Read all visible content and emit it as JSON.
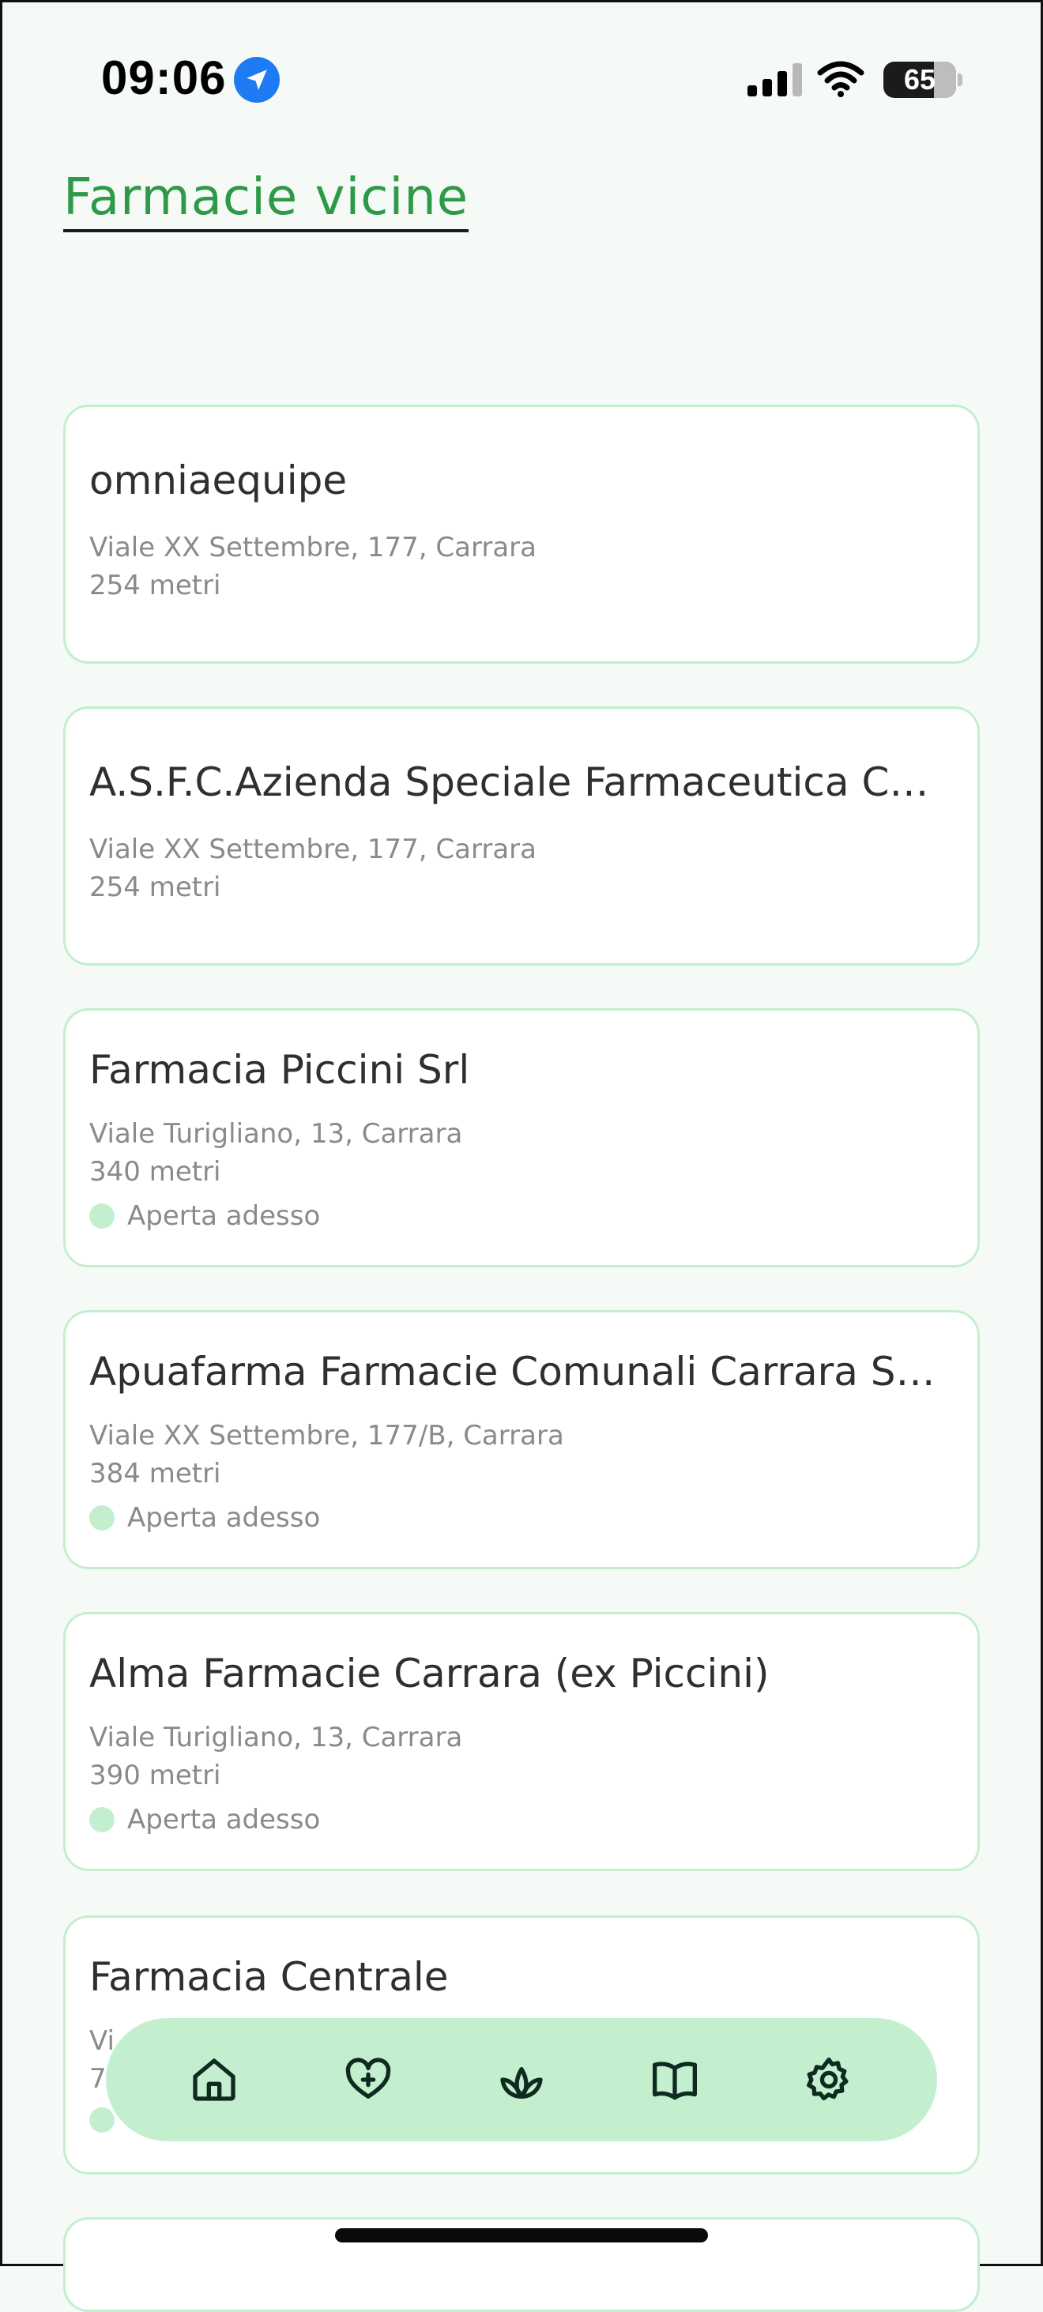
{
  "status": {
    "time": "09:06",
    "battery": "65"
  },
  "title": "Farmacie vicine",
  "pharmacies": [
    {
      "name": "omniaequipe",
      "address": "Viale XX Settembre, 177, Carrara",
      "distance": "254 metri",
      "open": ""
    },
    {
      "name": "A.S.F.C.Azienda Speciale Farmaceutica Carrara",
      "address": "Viale XX Settembre, 177, Carrara",
      "distance": "254 metri",
      "open": ""
    },
    {
      "name": "Farmacia Piccini Srl",
      "address": "Viale Turigliano, 13, Carrara",
      "distance": "340 metri",
      "open": "Aperta adesso"
    },
    {
      "name": "Apuafarma Farmacie Comunali Carrara S.p.A.",
      "address": "Viale XX Settembre, 177/B, Carrara",
      "distance": "384 metri",
      "open": "Aperta adesso"
    },
    {
      "name": "Alma Farmacie Carrara (ex Piccini)",
      "address": "Viale Turigliano, 13, Carrara",
      "distance": "390 metri",
      "open": "Aperta adesso"
    },
    {
      "name": "Farmacia Centrale",
      "address": "Vi",
      "distance": "7",
      "open": ""
    }
  ],
  "nav": {
    "items": [
      "home-icon",
      "heart-plus-icon",
      "lotus-icon",
      "book-icon",
      "gear-icon"
    ]
  },
  "colors": {
    "accent": "#2e9a48",
    "card_border": "#c3efcf",
    "nav_bg": "#c3efcf",
    "background": "#f6faf6"
  }
}
